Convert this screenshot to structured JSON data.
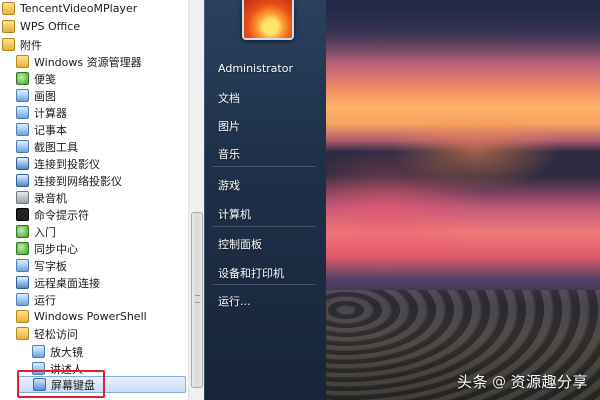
{
  "programs": [
    {
      "label": "TencentVideoMPlayer",
      "icon": "folder-icon",
      "indent": 0
    },
    {
      "label": "WPS Office",
      "icon": "folder-icon",
      "indent": 0
    },
    {
      "label": "附件",
      "icon": "folder-icon",
      "indent": 0
    },
    {
      "label": "Windows 资源管理器",
      "icon": "explorer-icon",
      "indent": 1
    },
    {
      "label": "便笺",
      "icon": "sticky-notes-icon",
      "indent": 1
    },
    {
      "label": "画图",
      "icon": "paint-icon",
      "indent": 1
    },
    {
      "label": "计算器",
      "icon": "calculator-icon",
      "indent": 1
    },
    {
      "label": "记事本",
      "icon": "notepad-icon",
      "indent": 1
    },
    {
      "label": "截图工具",
      "icon": "snipping-tool-icon",
      "indent": 1
    },
    {
      "label": "连接到投影仪",
      "icon": "projector-icon",
      "indent": 1
    },
    {
      "label": "连接到网络投影仪",
      "icon": "network-projector-icon",
      "indent": 1
    },
    {
      "label": "录音机",
      "icon": "microphone-icon",
      "indent": 1
    },
    {
      "label": "命令提示符",
      "icon": "command-prompt-icon",
      "indent": 1
    },
    {
      "label": "入门",
      "icon": "getting-started-icon",
      "indent": 1
    },
    {
      "label": "同步中心",
      "icon": "sync-center-icon",
      "indent": 1
    },
    {
      "label": "写字板",
      "icon": "wordpad-icon",
      "indent": 1
    },
    {
      "label": "远程桌面连接",
      "icon": "remote-desktop-icon",
      "indent": 1
    },
    {
      "label": "运行",
      "icon": "run-icon",
      "indent": 1
    },
    {
      "label": "Windows PowerShell",
      "icon": "folder-icon",
      "indent": 1
    },
    {
      "label": "轻松访问",
      "icon": "folder-icon",
      "indent": 1
    },
    {
      "label": "放大镜",
      "icon": "magnifier-icon",
      "indent": 2
    },
    {
      "label": "讲述人",
      "icon": "narrator-icon",
      "indent": 2
    },
    {
      "label": "屏幕键盘",
      "icon": "keyboard-icon",
      "indent": 2
    }
  ],
  "right_menu": {
    "user": "Administrator",
    "documents": "文档",
    "pictures": "图片",
    "music": "音乐",
    "games": "游戏",
    "computer": "计算机",
    "control_panel": "控制面板",
    "devices": "设备和打印机",
    "run": "运行..."
  },
  "watermark": {
    "brand": "头条",
    "separator": "@",
    "author": "资源趣分享"
  },
  "colors": {
    "highlight_border": "#e0232a",
    "start_panel": "#1e3049"
  }
}
